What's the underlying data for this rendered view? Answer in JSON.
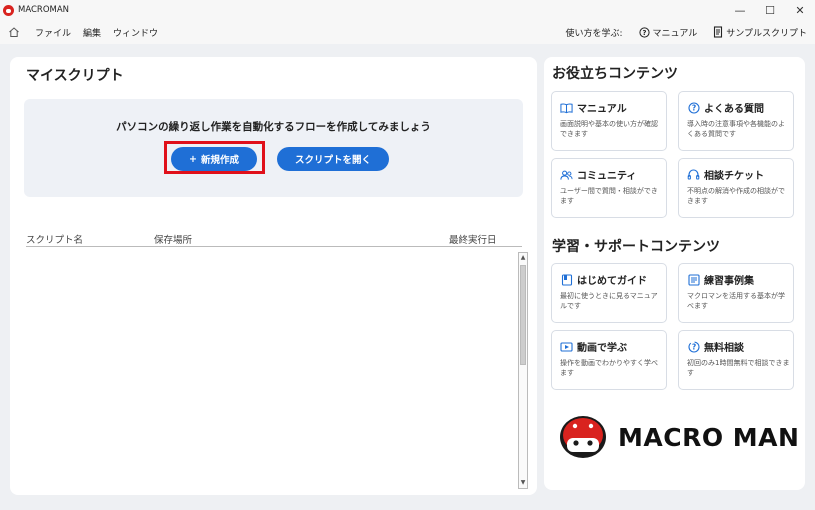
{
  "app": {
    "title": "MACROMAN"
  },
  "window_controls": {
    "minimize": "—",
    "maximize": "☐",
    "close": "✕"
  },
  "menu": {
    "items": [
      "ファイル",
      "編集",
      "ウィンドウ"
    ],
    "right": {
      "learn": "使い方を学ぶ:",
      "manual": "マニュアル",
      "sample": "サンプルスクリプト"
    }
  },
  "left": {
    "title": "マイスクリプト",
    "hero_text": "パソコンの繰り返し作業を自動化するフローを作成してみましょう",
    "new_button": "新規作成",
    "new_button_prefix": "+",
    "open_button": "スクリプトを開く",
    "table": {
      "columns": [
        "スクリプト名",
        "保存場所",
        "最終実行日"
      ],
      "rows": []
    }
  },
  "right": {
    "section1_title": "お役立ちコンテンツ",
    "section1_cards": [
      {
        "icon": "book-icon",
        "title": "マニュアル",
        "desc": "画面説明や基本の使い方が確認できます"
      },
      {
        "icon": "question-icon",
        "title": "よくある質問",
        "desc": "導入時の注意事項や各機能のよくある質問です"
      },
      {
        "icon": "people-icon",
        "title": "コミュニティ",
        "desc": "ユーザー間で質問・相談ができます"
      },
      {
        "icon": "headset-icon",
        "title": "相談チケット",
        "desc": "不明点の解消や作成の相談ができます"
      }
    ],
    "section2_title": "学習・サポートコンテンツ",
    "section2_cards": [
      {
        "icon": "guide-icon",
        "title": "はじめてガイド",
        "desc": "最初に使うときに見るマニュアルです"
      },
      {
        "icon": "list-icon",
        "title": "練習事例集",
        "desc": "マクロマンを活用する基本が学べます"
      },
      {
        "icon": "video-icon",
        "title": "動画で学ぶ",
        "desc": "操作を動画でわかりやすく学べます"
      },
      {
        "icon": "consult-icon",
        "title": "無料相談",
        "desc": "初回のみ1時間無料で相談できます"
      }
    ],
    "logo_text": "MACRO MAN"
  },
  "colors": {
    "accent": "#1f6fd6",
    "highlight": "#e0101a",
    "brand_red": "#d9231f"
  }
}
